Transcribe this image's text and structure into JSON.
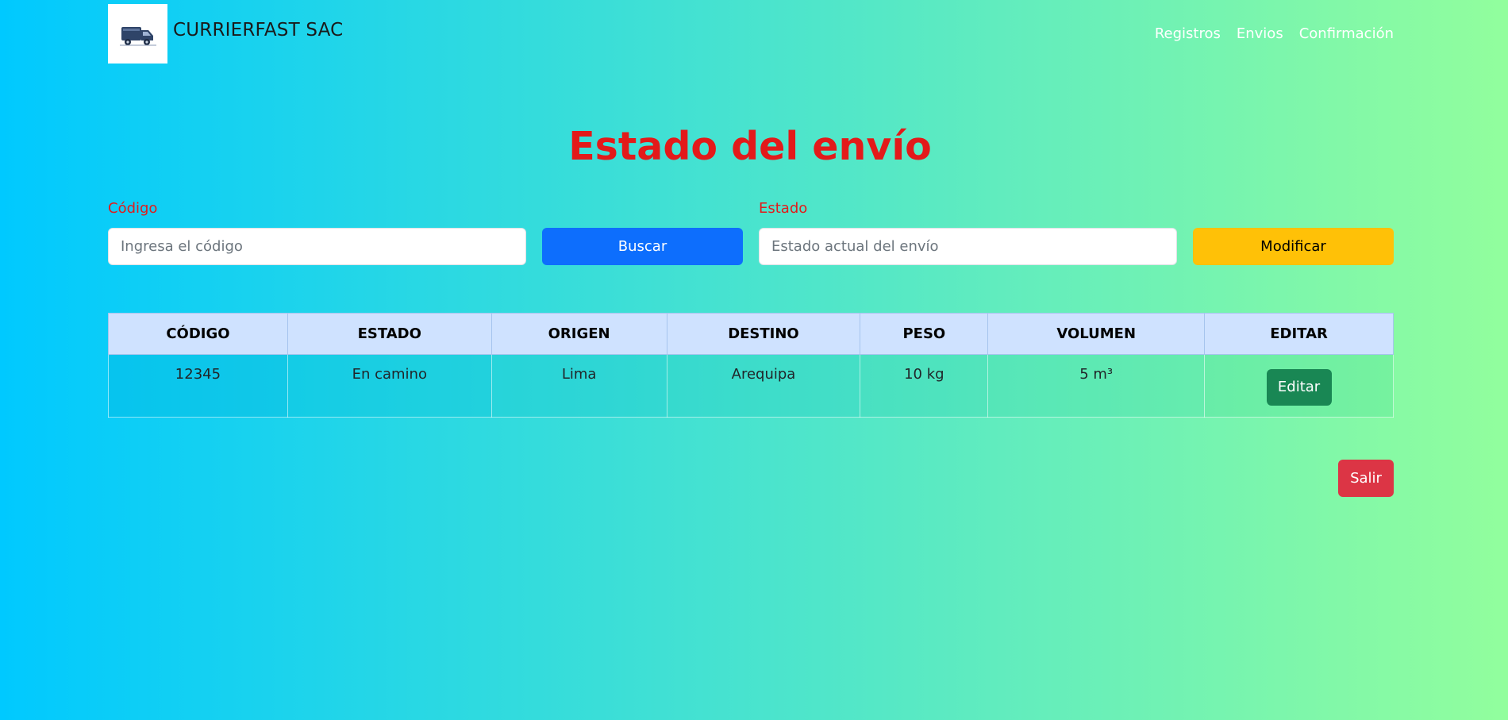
{
  "brand": {
    "name": "CURRIERFAST SAC",
    "logo_icon": "truck-icon"
  },
  "nav": {
    "items": [
      "Registros",
      "Envios",
      "Confirmación"
    ]
  },
  "page": {
    "title": "Estado del envío"
  },
  "search": {
    "code_label": "Código",
    "code_placeholder": "Ingresa el código",
    "search_button": "Buscar",
    "state_label": "Estado",
    "state_placeholder": "Estado actual del envío",
    "modify_button": "Modificar"
  },
  "table": {
    "headers": [
      "CÓDIGO",
      "ESTADO",
      "ORIGEN",
      "DESTINO",
      "PESO",
      "VOLUMEN",
      "EDITAR"
    ],
    "rows": [
      {
        "codigo": "12345",
        "estado": "En camino",
        "origen": "Lima",
        "destino": "Arequipa",
        "peso": "10 kg",
        "volumen": "5 m³",
        "editar": "Editar"
      }
    ]
  },
  "footer": {
    "exit_button": "Salir"
  },
  "colors": {
    "gradient_start": "#00c9ff",
    "gradient_end": "#92fe9d",
    "title": "#e31a1a",
    "primary": "#0d6efd",
    "warning": "#ffc107",
    "success": "#198754",
    "danger": "#dc3545",
    "table_header": "#cfe2ff"
  }
}
